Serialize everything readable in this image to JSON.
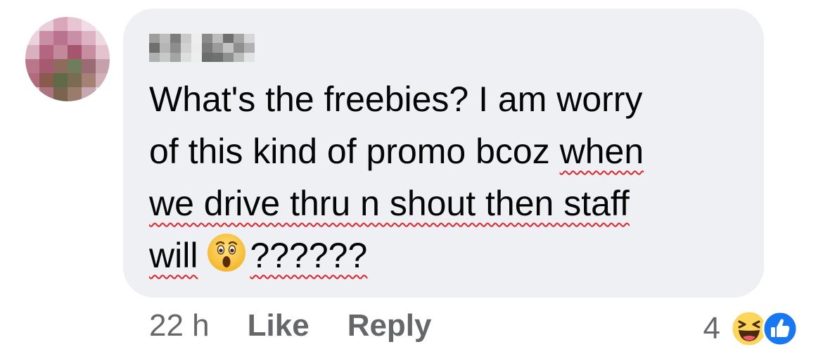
{
  "comment": {
    "author_blurred": true,
    "lines": [
      "What's the freebies? I am worry",
      "of this kind of promo bcoz ",
      "when",
      "we drive thru n shout then staff",
      "will",
      "??????"
    ],
    "emoji": "astonished-face-emoji"
  },
  "actions": {
    "timestamp": "22 h",
    "like_label": "Like",
    "reply_label": "Reply"
  },
  "reactions": {
    "count": "4",
    "icons": [
      "haha-reaction-icon",
      "like-reaction-icon"
    ]
  },
  "colors": {
    "bubble": "#eef0f3",
    "text": "#050505",
    "secondary": "#65676b",
    "spellcheck": "#e0242b",
    "like_blue": "#1877f2"
  }
}
